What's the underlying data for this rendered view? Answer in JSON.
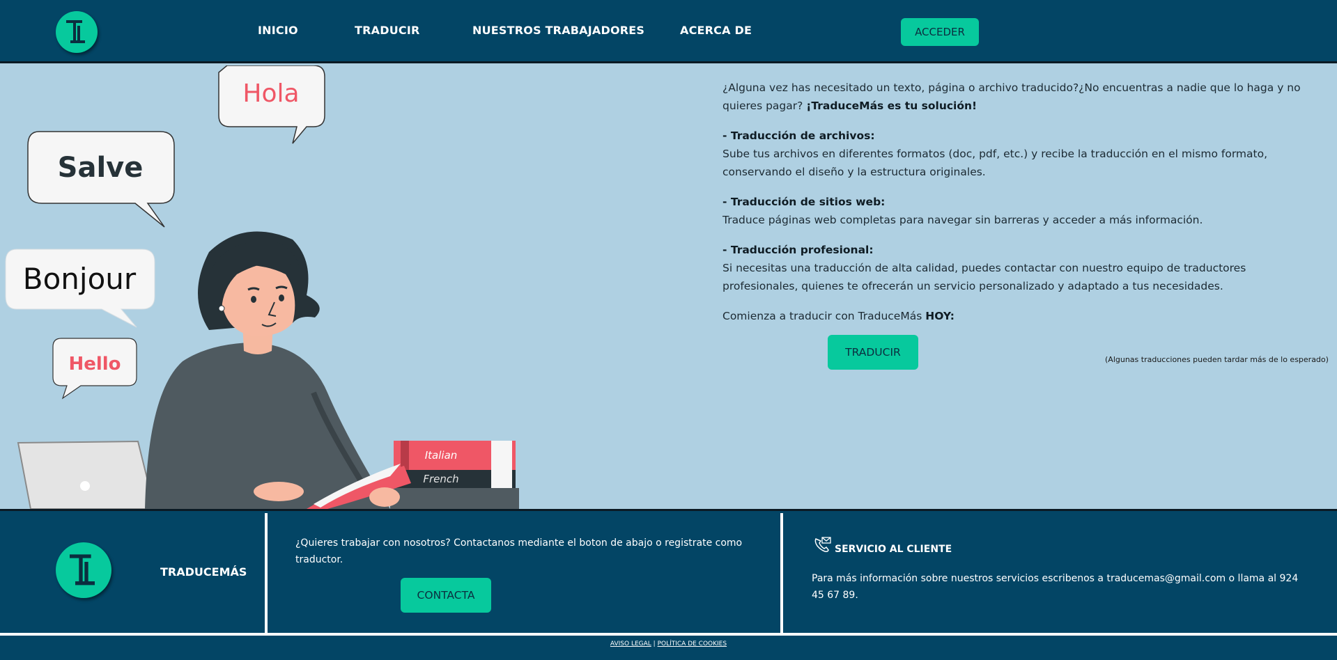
{
  "nav": {
    "items": [
      {
        "label": "INICIO"
      },
      {
        "label": "TRADUCIR"
      },
      {
        "label": "NUESTROS TRABAJADORES"
      },
      {
        "label": "ACERCA DE"
      }
    ],
    "login_label": "ACCEDER",
    "logo_letters": "TI"
  },
  "illustration": {
    "bubbles": [
      "Hola",
      "Salve",
      "Bonjour",
      "Hello"
    ],
    "books": [
      "Italian",
      "French"
    ]
  },
  "hero": {
    "intro_part1": "¿Alguna vez has necesitado un texto, página o archivo traducido?¿No encuentras a nadie que lo haga y no quieres pagar? ",
    "intro_bold": "¡TraduceMás es tu solución!",
    "sections": [
      {
        "title": "- Traducción de archivos:",
        "text": "Sube tus archivos en diferentes formatos (doc, pdf, etc.) y recibe la traducción en el mismo formato, conservando el diseño y la estructura originales."
      },
      {
        "title": "- Traducción de sitios web:",
        "text": "Traduce páginas web completas para navegar sin barreras y acceder a más información."
      },
      {
        "title": "- Traducción profesional:",
        "text": "Si necesitas una traducción de alta calidad, puedes contactar con nuestro equipo de traductores profesionales, quienes te ofrecerán un servicio personalizado y adaptado a tus necesidades."
      }
    ],
    "cta_text": "Comienza a traducir con TraduceMás ",
    "cta_bold": "HOY:",
    "translate_button": "TRADUCIR",
    "note": "(Algunas traducciones pueden tardar más de lo esperado)"
  },
  "footer": {
    "brand": "TRADUCEMÁS",
    "work_text": "¿Quieres trabajar con nosotros? Contactanos mediante el boton de abajo o registrate como traductor.",
    "contact_button": "CONTACTA",
    "service_title": "SERVICIO AL CLIENTE",
    "service_text": "Para más información sobre nuestros servicios escribenos a traducemas@gmail.com o llama al 924 45 67 89.",
    "legal_link": "AVISO LEGAL",
    "legal_sep": " | ",
    "cookies_link": "POLÍTICA DE COOKIES"
  },
  "colors": {
    "primary": "#034565",
    "accent": "#07c99d",
    "hero_bg": "#afd0e2"
  }
}
